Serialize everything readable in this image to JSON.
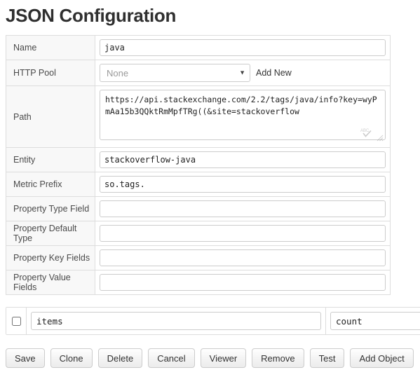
{
  "page": {
    "title": "JSON Configuration"
  },
  "form": {
    "rows": [
      {
        "label": "Name",
        "value": "java",
        "type": "text"
      },
      {
        "label": "HTTP Pool",
        "value": "None",
        "type": "select",
        "link_label": "Add New"
      },
      {
        "label": "Path",
        "value": "https://api.stackexchange.com/2.2/tags/java/info?key=wyPmAa15b3QQktRmMpfTRg((&site=stackoverflow",
        "type": "textarea"
      },
      {
        "label": "Entity",
        "value": "stackoverflow-java",
        "type": "text"
      },
      {
        "label": "Metric Prefix",
        "value": "so.tags.",
        "type": "text"
      },
      {
        "label": "Property Type Field",
        "value": "",
        "type": "text"
      },
      {
        "label": "Property Default Type",
        "value": "",
        "type": "text"
      },
      {
        "label": "Property Key Fields",
        "value": "",
        "type": "text"
      },
      {
        "label": "Property Value Fields",
        "value": "",
        "type": "text"
      }
    ]
  },
  "object_row": {
    "checkbox_checked": false,
    "field_one": "items",
    "field_two": "count"
  },
  "buttons": [
    {
      "label": "Save"
    },
    {
      "label": "Clone"
    },
    {
      "label": "Delete"
    },
    {
      "label": "Cancel"
    },
    {
      "label": "Viewer"
    },
    {
      "label": "Remove"
    },
    {
      "label": "Test"
    },
    {
      "label": "Add Object"
    }
  ],
  "colors": {
    "text": "#333333",
    "label_bg": "#f8f8f8",
    "border": "#dddddd",
    "input_border": "#cccccc",
    "placeholder": "#999999"
  }
}
